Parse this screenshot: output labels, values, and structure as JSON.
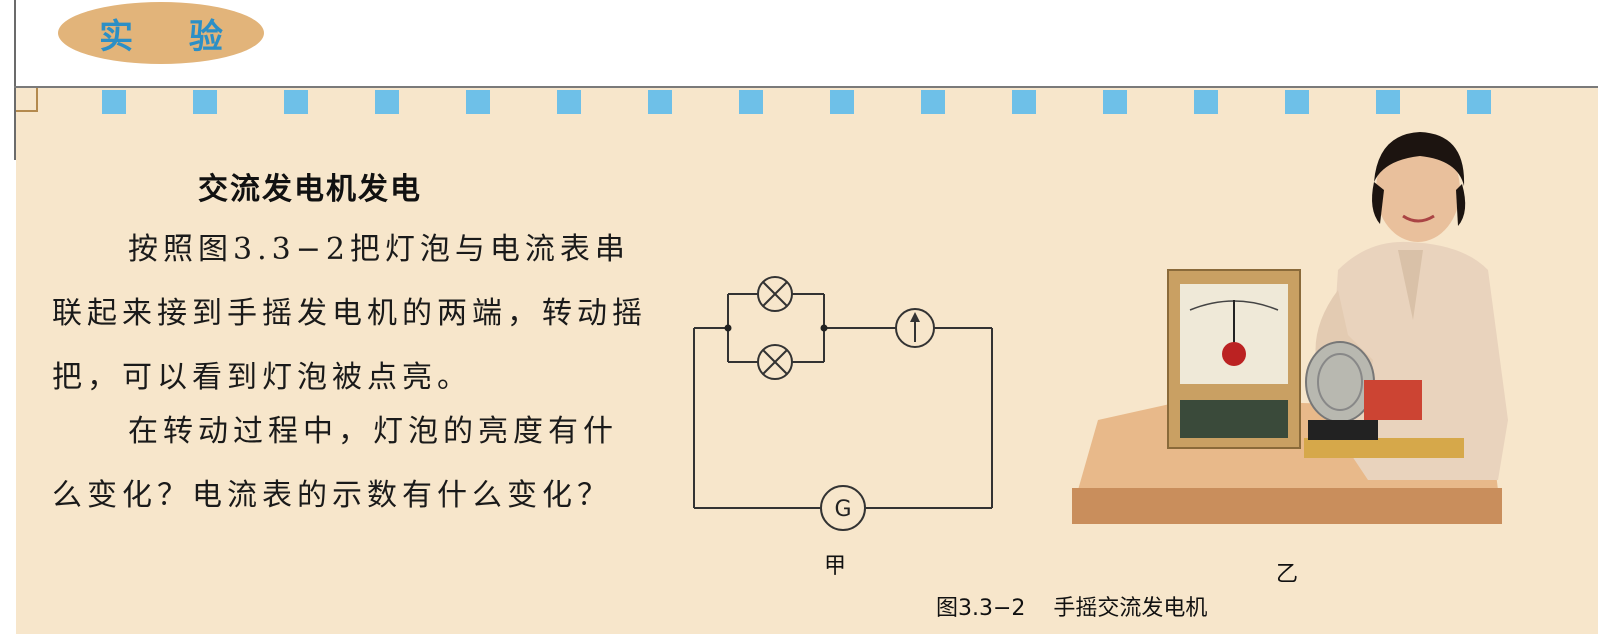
{
  "header": {
    "badge": "实 验"
  },
  "article": {
    "title": "交流发电机发电",
    "paragraph1": "按照图3.3−2把灯泡与电流表串联起来接到手摇发电机的两端，转动摇把，可以看到灯泡被点亮。",
    "paragraph2": "在转动过程中，灯泡的亮度有什么变化？电流表的示数有什么变化？"
  },
  "figure": {
    "galvanometer_letter": "G",
    "label_a": "甲",
    "label_b": "乙",
    "caption": "图3.3−2    手摇交流发电机"
  },
  "colors": {
    "badge_fill": "#e2b47a",
    "badge_text": "#2c8fc6",
    "page_bg": "#f7e6cb",
    "decor_squares": "#6ec0e8"
  }
}
